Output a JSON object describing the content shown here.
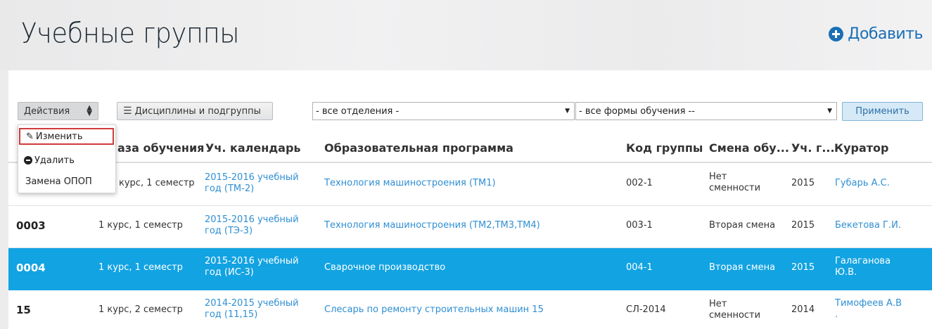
{
  "header": {
    "title": "Учебные группы",
    "add_label": "Добавить"
  },
  "toolbar": {
    "actions_label": "Действия",
    "disciplines_label": "Дисциплины и подгруппы",
    "department_select": "- все отделения -",
    "form_select": "- все формы обучения --",
    "apply_label": "Применить"
  },
  "actions_menu": {
    "items": [
      {
        "label": "Изменить",
        "icon": "pencil-icon"
      },
      {
        "label": "Удалить",
        "icon": "minus-circle-icon"
      },
      {
        "label": "Замена ОПОП",
        "icon": ""
      }
    ]
  },
  "table": {
    "columns": [
      "Фаза обучения",
      "Уч. календарь",
      "Образовательная программа",
      "Код группы",
      "Смена обу...",
      "Уч. г...",
      "Куратор"
    ],
    "visible_partial_first_column": "аза обучения",
    "rows": [
      {
        "code": "",
        "phase": "курс, 1 семестр",
        "calendar_1": "2015-2016 учебный",
        "calendar_2": "год (ТМ-2)",
        "program": "Технология машиностроения (ТМ1)",
        "group_code": "002-1",
        "shift_1": "Нет",
        "shift_2": "сменности",
        "year": "2015",
        "curator_1": "Губарь А.С.",
        "curator_2": ""
      },
      {
        "code": "0003",
        "phase": "1 курс, 1 семестр",
        "calendar_1": "2015-2016 учебный",
        "calendar_2": "год (ТЭ-3)",
        "program": "Технология машиностроения (ТМ2,ТМ3,ТМ4)",
        "group_code": "003-1",
        "shift_1": "Вторая смена",
        "shift_2": "",
        "year": "2015",
        "curator_1": "Бекетова Г.И.",
        "curator_2": ""
      },
      {
        "code": "0004",
        "phase": "1 курс, 1 семестр",
        "calendar_1": "2015-2016 учебный",
        "calendar_2": "год (ИС-3)",
        "program": "Сварочное производство",
        "group_code": "004-1",
        "shift_1": "Вторая смена",
        "shift_2": "",
        "year": "2015",
        "curator_1": "Галаганова",
        "curator_2": "Ю.В."
      },
      {
        "code": "15",
        "phase": "1 курс, 2 семестр",
        "calendar_1": "2014-2015 учебный",
        "calendar_2": "год (11,15)",
        "program": "Слесарь по ремонту строительных машин 15",
        "group_code": "СЛ-2014",
        "shift_1": "Нет",
        "shift_2": "сменности",
        "year": "2014",
        "curator_1": "Тимофеев А.В",
        "curator_2": "."
      }
    ]
  },
  "colors": {
    "accent": "#1a6fb5",
    "link": "#2f8fd3",
    "selected_row": "#12a3e2",
    "menu_highlight": "#d23a3a"
  }
}
